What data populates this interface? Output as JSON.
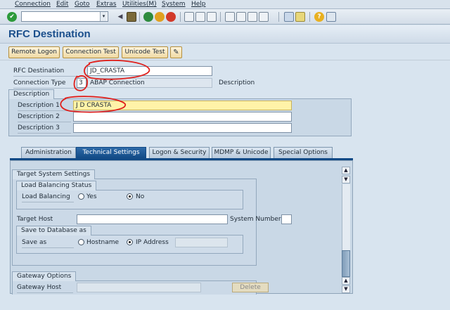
{
  "menu": [
    "Connection",
    "Edit",
    "Goto",
    "Extras",
    "Utilities(M)",
    "System",
    "Help"
  ],
  "toolbar": {
    "command_value": "",
    "icons": [
      "enter-icon",
      "back-icon",
      "save-icon",
      "exit-icon",
      "cancel-icon",
      "print-icon",
      "find-icon",
      "find-next-icon",
      "first-page-icon",
      "previous-page-icon",
      "next-page-icon",
      "last-page-icon",
      "new-session-icon",
      "shortcut-icon",
      "help-icon",
      "layout-icon"
    ]
  },
  "page": {
    "title": "RFC Destination"
  },
  "app_toolbar": {
    "remote_logon": "Remote Logon",
    "connection_test": "Connection Test",
    "unicode_test": "Unicode Test",
    "edit_icon": "pencil-glasses-icon"
  },
  "header": {
    "rfc_destination_label": "RFC Destination",
    "rfc_destination_value": "JD_CRASTA",
    "connection_type_label": "Connection Type",
    "connection_type_code": "3",
    "connection_type_text": "ABAP Connection",
    "description_label": "Description"
  },
  "description_group": {
    "title": "Description",
    "description1_label": "Description 1",
    "description1_value": "J D CRASTA",
    "description2_label": "Description 2",
    "description2_value": "",
    "description3_label": "Description 3",
    "description3_value": ""
  },
  "tabs": [
    {
      "label": "Administration",
      "active": false
    },
    {
      "label": "Technical Settings",
      "active": true
    },
    {
      "label": "Logon & Security",
      "active": false
    },
    {
      "label": "MDMP & Unicode",
      "active": false
    },
    {
      "label": "Special Options",
      "active": false
    }
  ],
  "target_system": {
    "title": "Target System Settings",
    "load_balancing_group": "Load Balancing Status",
    "load_balancing_label": "Load Balancing",
    "yes_label": "Yes",
    "no_label": "No",
    "load_balancing_selected": "No",
    "target_host_label": "Target Host",
    "target_host_value": "",
    "system_number_label": "System Number",
    "system_number_value": "",
    "save_db_group": "Save to Database as",
    "save_as_label": "Save as",
    "hostname_label": "Hostname",
    "ip_address_label": "IP Address",
    "save_as_selected": "IP Address",
    "ip_value": ""
  },
  "gateway": {
    "title": "Gateway Options",
    "gateway_host_label": "Gateway Host",
    "gateway_host_value": "",
    "delete_label": "Delete"
  },
  "colors": {
    "title_blue": "#1b4f8c",
    "active_tab": "#124a86",
    "annotation_red": "#e0201c",
    "highlight_field": "#fff3a8"
  }
}
